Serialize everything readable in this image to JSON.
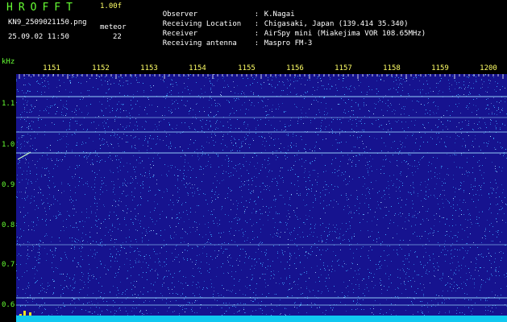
{
  "header": {
    "app_title": "HROFFT",
    "app_version": "1.00f",
    "file_name": "KN9_2509021150.png",
    "meteor_label": "meteor",
    "timestamp": "25.09.02 11:50",
    "meteor_count": "22"
  },
  "info": [
    {
      "key": "Observer",
      "value": "K.Nagai"
    },
    {
      "key": "Receiving Location",
      "value": "Chigasaki, Japan (139.414 35.340)"
    },
    {
      "key": "Receiver",
      "value": "AirSpy mini (Miakejima VOR 108.65MHz)"
    },
    {
      "key": "Receiving antenna",
      "value": "Maspro FM-3"
    }
  ],
  "axis": {
    "y_unit": "kHz",
    "y_ticks": [
      "1.1",
      "1.0",
      "0.9",
      "0.8",
      "0.7",
      "0.6"
    ],
    "x_ticks": [
      "1151",
      "1152",
      "1153",
      "1154",
      "1155",
      "1156",
      "1157",
      "1158",
      "1159",
      "1200"
    ]
  },
  "colors": {
    "background": "#16138f",
    "noise": "#3fa8ff",
    "carrier": "#9fdcff",
    "floor": "#10c8f0",
    "header_green": "#66ff33",
    "header_yellow": "#ffff66"
  }
}
